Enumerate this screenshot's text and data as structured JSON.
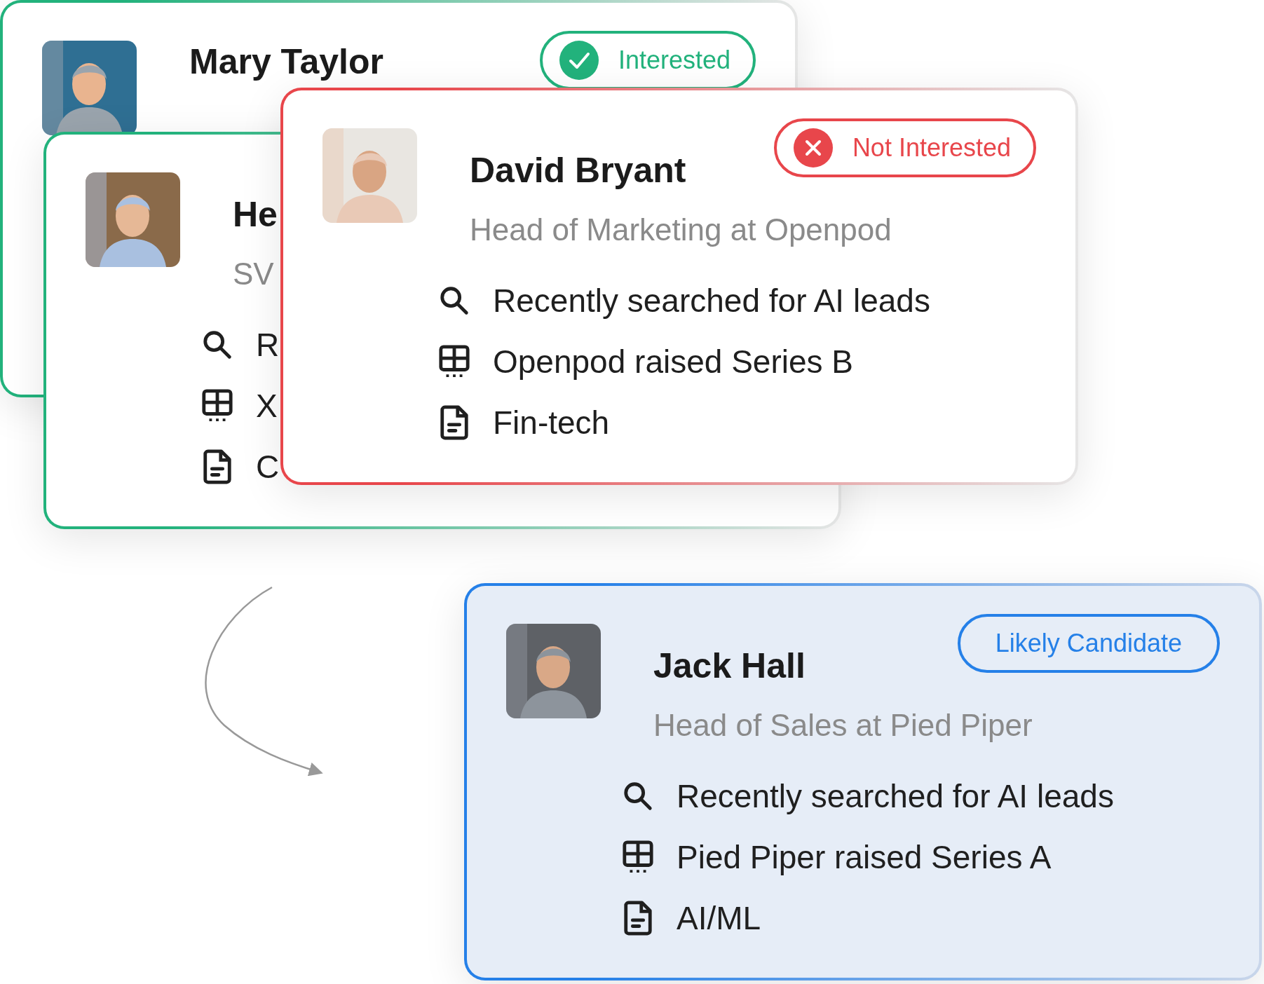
{
  "cards": [
    {
      "name": "Mary Taylor",
      "color": "#22b27c",
      "highlighted": false,
      "avatar": {
        "kind": "picture"
      },
      "status": {
        "label": "Interested",
        "kind": "check"
      }
    },
    {
      "name": "He",
      "title": "SV",
      "color": "#22b27c",
      "highlighted": false,
      "avatar": {
        "kind": "picture"
      },
      "items": [
        {
          "kind": "search",
          "text": "R"
        },
        {
          "kind": "table",
          "text": "X"
        },
        {
          "kind": "document",
          "text": "C"
        }
      ]
    },
    {
      "name": "David Bryant",
      "title": "Head of Marketing at Openpod",
      "color": "#e8464b",
      "highlighted": false,
      "avatar": {
        "kind": "picture"
      },
      "status": {
        "label": "Not Interested",
        "kind": "cross"
      },
      "items": [
        {
          "kind": "search",
          "text": "Recently searched for AI leads"
        },
        {
          "kind": "table",
          "text": "Openpod raised Series B"
        },
        {
          "kind": "document",
          "text": "Fin-tech"
        }
      ]
    },
    {
      "name": "Jack Hall",
      "title": "Head of Sales at Pied Piper",
      "color": "#2580e8",
      "highlighted": true,
      "avatar": {
        "kind": "picture"
      },
      "status": {
        "label": "Likely Candidate",
        "kind": "plain"
      },
      "items": [
        {
          "kind": "search",
          "text": "Recently searched for AI leads"
        },
        {
          "kind": "table",
          "text": "Pied Piper raised Series A"
        },
        {
          "kind": "document",
          "text": "AI/ML"
        }
      ]
    }
  ]
}
